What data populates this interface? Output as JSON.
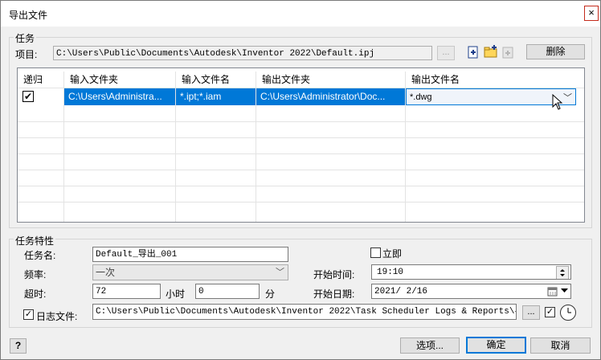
{
  "window": {
    "title": "导出文件",
    "close_glyph": "×"
  },
  "tasks_group": {
    "label": "任务",
    "project_label": "项目:",
    "project_path": "C:\\Users\\Public\\Documents\\Autodesk\\Inventor 2022\\Default.ipj",
    "browse_label": "...",
    "delete_label": "删除"
  },
  "grid": {
    "columns": [
      "递归",
      "输入文件夹",
      "输入文件名",
      "输出文件夹",
      "输出文件名"
    ],
    "rows": [
      {
        "recursive": "✔",
        "input_folder": "C:\\Users\\Administra...",
        "input_name": "*.ipt;*.iam",
        "output_folder": "C:\\Users\\Administrator\\Doc...",
        "output_name": "*.dwg"
      }
    ]
  },
  "props_group": {
    "label": "任务特性",
    "task_name_label": "任务名:",
    "task_name_value": "Default_导出_001",
    "immediate_label": "立即",
    "frequency_label": "频率:",
    "frequency_value": "一次",
    "start_time_label": "开始时间:",
    "start_time_value": "19:10",
    "timeout_label": "超时:",
    "timeout_value": "72",
    "hours_label": "小时",
    "minutes_value": "0",
    "minutes_label": "分",
    "start_date_label": "开始日期:",
    "start_date_value": "2021/ 2/16",
    "log_label": "日志文件:",
    "log_path": "C:\\Users\\Public\\Documents\\Autodesk\\Inventor 2022\\Task Scheduler Logs & Reports\\导出.log",
    "log_browse_label": "..."
  },
  "footer": {
    "help_glyph": "?",
    "options_label": "选项...",
    "ok_label": "确定",
    "cancel_label": "取消"
  },
  "colors": {
    "selection": "#0078d7",
    "accent": "#0078d7"
  }
}
